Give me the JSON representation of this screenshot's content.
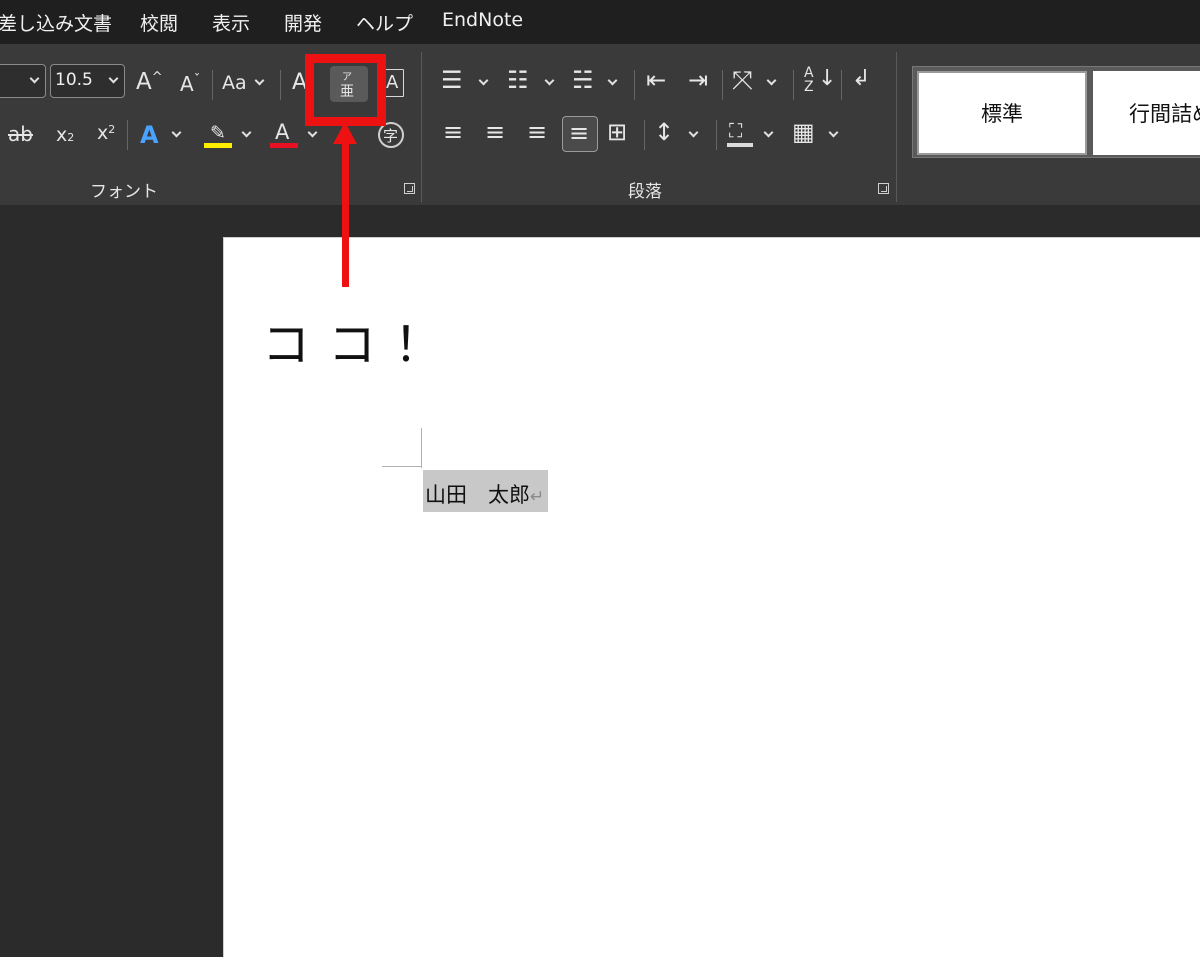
{
  "menu": [
    "差し込み文書",
    "校閲",
    "表示",
    "開発",
    "ヘルプ",
    "EndNote"
  ],
  "font_group": {
    "label": "フォント",
    "font_size": "10.5",
    "change_case_label": "Aa",
    "grow_font_label": "A",
    "shrink_font_label": "A",
    "subscript_label": "x",
    "superscript_label": "x",
    "font_color_label": "A",
    "text_effects_label": "A",
    "clear_format_label": "A",
    "phonetic_guide_label": "ア",
    "enclose_label": "字",
    "char_border_label": "A"
  },
  "paragraph_group": {
    "label": "段落"
  },
  "styles": [
    "標準",
    "行間詰め"
  ],
  "document": {
    "annotation_text": "ココ！",
    "name_text": "山田　太郎",
    "para_mark": "↵"
  },
  "colors": {
    "highlight_accent": "#ee1111",
    "highlighter_yellow": "#ffee00",
    "font_color_red": "#e81123",
    "text_effect_blue": "#4aa3ff"
  }
}
